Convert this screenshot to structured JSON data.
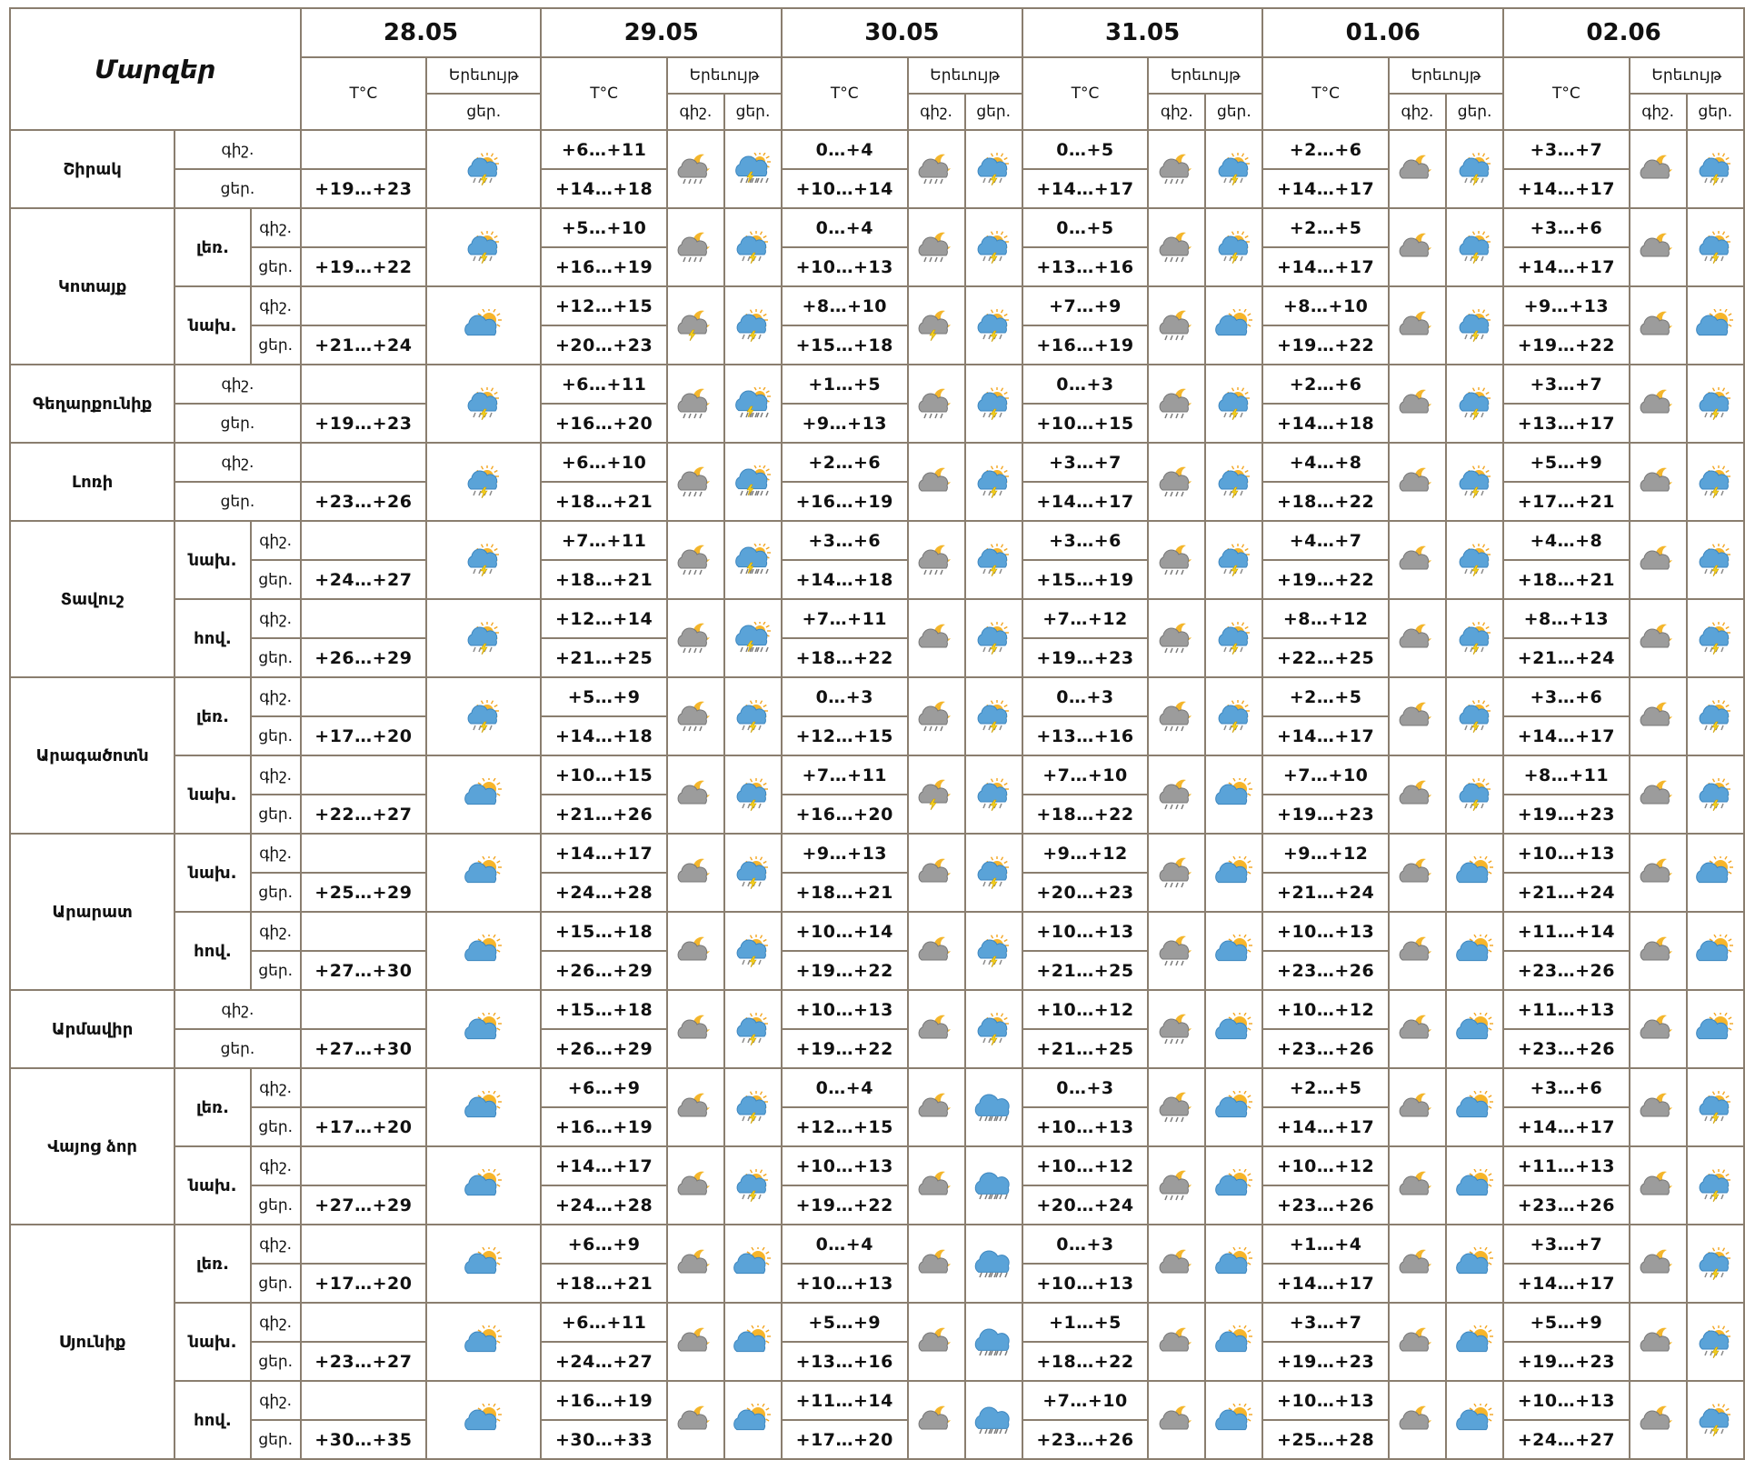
{
  "header": {
    "regions_title": "Մարզեր",
    "temp_label": "T°C",
    "phenomenon_label": "Երեւույթ",
    "night_label": "գիշ.",
    "day_label": "ցեր.",
    "dates": [
      "28.05",
      "29.05",
      "30.05",
      "31.05",
      "01.06",
      "02.06"
    ]
  },
  "icon_legend": {
    "sun-shower": "partly sunny cloud with light rain",
    "sun-thunder-rain": "sun, cloud, lightning and rain",
    "sun-cloud": "sun behind blue cloud",
    "night-cloud": "moon behind grey cloud",
    "night-cloud-rain": "moon behind grey cloud with drizzle",
    "night-cloud-thunder": "moon behind grey cloud with lightning",
    "rain-cloud": "blue cloud with rain"
  },
  "regions": [
    {
      "name": "Շիրակ",
      "subs": [
        {
          "label": "",
          "night": [
            "",
            "+6…+11",
            "0…+4",
            "0…+5",
            "+2…+6",
            "+3…+7"
          ],
          "day": [
            "+19…+23",
            "+14…+18",
            "+10…+14",
            "+14…+17",
            "+14…+17",
            "+14…+17"
          ],
          "icons_n": [
            "night-cloud-rain",
            "night-cloud-rain",
            "night-cloud-rain",
            "night-cloud",
            "night-cloud"
          ],
          "icons_d": [
            "sun-shower",
            "sun-thunder-rain",
            "sun-shower",
            "sun-shower",
            "sun-shower",
            "sun-shower"
          ]
        }
      ]
    },
    {
      "name": "Կոտայք",
      "subs": [
        {
          "label": "լեռ.",
          "night": [
            "",
            "+5…+10",
            "0…+4",
            "0…+5",
            "+2…+5",
            "+3…+6"
          ],
          "day": [
            "+19…+22",
            "+16…+19",
            "+10…+13",
            "+13…+16",
            "+14…+17",
            "+14…+17"
          ],
          "icons_n": [
            "night-cloud-rain",
            "night-cloud-rain",
            "night-cloud-rain",
            "night-cloud",
            "night-cloud"
          ],
          "icons_d": [
            "sun-shower",
            "sun-shower",
            "sun-shower",
            "sun-shower",
            "sun-shower",
            "sun-shower"
          ]
        },
        {
          "label": "նախ.",
          "night": [
            "",
            "+12…+15",
            "+8…+10",
            "+7…+9",
            "+8…+10",
            "+9…+13"
          ],
          "day": [
            "+21…+24",
            "+20…+23",
            "+15…+18",
            "+16…+19",
            "+19…+22",
            "+19…+22"
          ],
          "icons_n": [
            "night-cloud-thunder",
            "night-cloud-thunder",
            "night-cloud-rain",
            "night-cloud",
            "night-cloud"
          ],
          "icons_d": [
            "sun-cloud",
            "sun-shower",
            "sun-shower",
            "sun-cloud",
            "sun-shower",
            "sun-cloud"
          ]
        }
      ]
    },
    {
      "name": "Գեղարքունիք",
      "subs": [
        {
          "label": "",
          "night": [
            "",
            "+6…+11",
            "+1…+5",
            "0…+3",
            "+2…+6",
            "+3…+7"
          ],
          "day": [
            "+19…+23",
            "+16…+20",
            "+9…+13",
            "+10…+15",
            "+14…+18",
            "+13…+17"
          ],
          "icons_n": [
            "night-cloud-rain",
            "night-cloud-rain",
            "night-cloud-rain",
            "night-cloud",
            "night-cloud"
          ],
          "icons_d": [
            "sun-shower",
            "sun-thunder-rain",
            "sun-shower",
            "sun-shower",
            "sun-shower",
            "sun-shower"
          ]
        }
      ]
    },
    {
      "name": "Լոռի",
      "subs": [
        {
          "label": "",
          "night": [
            "",
            "+6…+10",
            "+2…+6",
            "+3…+7",
            "+4…+8",
            "+5…+9"
          ],
          "day": [
            "+23…+26",
            "+18…+21",
            "+16…+19",
            "+14…+17",
            "+18…+22",
            "+17…+21"
          ],
          "icons_n": [
            "night-cloud-rain",
            "night-cloud",
            "night-cloud-rain",
            "night-cloud",
            "night-cloud"
          ],
          "icons_d": [
            "sun-shower",
            "sun-thunder-rain",
            "sun-shower",
            "sun-shower",
            "sun-shower",
            "sun-shower"
          ]
        }
      ]
    },
    {
      "name": "Տավուշ",
      "subs": [
        {
          "label": "նախ.",
          "night": [
            "",
            "+7…+11",
            "+3…+6",
            "+3…+6",
            "+4…+7",
            "+4…+8"
          ],
          "day": [
            "+24…+27",
            "+18…+21",
            "+14…+18",
            "+15…+19",
            "+19…+22",
            "+18…+21"
          ],
          "icons_n": [
            "night-cloud-rain",
            "night-cloud-rain",
            "night-cloud-rain",
            "night-cloud",
            "night-cloud"
          ],
          "icons_d": [
            "sun-shower",
            "sun-thunder-rain",
            "sun-shower",
            "sun-shower",
            "sun-shower",
            "sun-shower"
          ]
        },
        {
          "label": "հով.",
          "night": [
            "",
            "+12…+14",
            "+7…+11",
            "+7…+12",
            "+8…+12",
            "+8…+13"
          ],
          "day": [
            "+26…+29",
            "+21…+25",
            "+18…+22",
            "+19…+23",
            "+22…+25",
            "+21…+24"
          ],
          "icons_n": [
            "night-cloud-rain",
            "night-cloud",
            "night-cloud-rain",
            "night-cloud",
            "night-cloud"
          ],
          "icons_d": [
            "sun-shower",
            "sun-thunder-rain",
            "sun-shower",
            "sun-shower",
            "sun-shower",
            "sun-shower"
          ]
        }
      ]
    },
    {
      "name": "Արագածոտն",
      "subs": [
        {
          "label": "լեռ.",
          "night": [
            "",
            "+5…+9",
            "0…+3",
            "0…+3",
            "+2…+5",
            "+3…+6"
          ],
          "day": [
            "+17…+20",
            "+14…+18",
            "+12…+15",
            "+13…+16",
            "+14…+17",
            "+14…+17"
          ],
          "icons_n": [
            "night-cloud-rain",
            "night-cloud-rain",
            "night-cloud-rain",
            "night-cloud",
            "night-cloud"
          ],
          "icons_d": [
            "sun-shower",
            "sun-shower",
            "sun-shower",
            "sun-shower",
            "sun-shower",
            "sun-shower"
          ]
        },
        {
          "label": "նախ.",
          "night": [
            "",
            "+10…+15",
            "+7…+11",
            "+7…+10",
            "+7…+10",
            "+8…+11"
          ],
          "day": [
            "+22…+27",
            "+21…+26",
            "+16…+20",
            "+18…+22",
            "+19…+23",
            "+19…+23"
          ],
          "icons_n": [
            "night-cloud",
            "night-cloud-thunder",
            "night-cloud-rain",
            "night-cloud",
            "night-cloud"
          ],
          "icons_d": [
            "sun-cloud",
            "sun-shower",
            "sun-shower",
            "sun-cloud",
            "sun-shower",
            "sun-shower"
          ]
        }
      ]
    },
    {
      "name": "Արարատ",
      "subs": [
        {
          "label": "նախ.",
          "night": [
            "",
            "+14…+17",
            "+9…+13",
            "+9…+12",
            "+9…+12",
            "+10…+13"
          ],
          "day": [
            "+25…+29",
            "+24…+28",
            "+18…+21",
            "+20…+23",
            "+21…+24",
            "+21…+24"
          ],
          "icons_n": [
            "night-cloud",
            "night-cloud",
            "night-cloud-rain",
            "night-cloud",
            "night-cloud"
          ],
          "icons_d": [
            "sun-cloud",
            "sun-shower",
            "sun-shower",
            "sun-cloud",
            "sun-cloud",
            "sun-cloud"
          ]
        },
        {
          "label": "հով.",
          "night": [
            "",
            "+15…+18",
            "+10…+14",
            "+10…+13",
            "+10…+13",
            "+11…+14"
          ],
          "day": [
            "+27…+30",
            "+26…+29",
            "+19…+22",
            "+21…+25",
            "+23…+26",
            "+23…+26"
          ],
          "icons_n": [
            "night-cloud",
            "night-cloud",
            "night-cloud-rain",
            "night-cloud",
            "night-cloud"
          ],
          "icons_d": [
            "sun-cloud",
            "sun-shower",
            "sun-shower",
            "sun-cloud",
            "sun-cloud",
            "sun-cloud"
          ]
        }
      ]
    },
    {
      "name": "Արմավիր",
      "subs": [
        {
          "label": "",
          "night": [
            "",
            "+15…+18",
            "+10…+13",
            "+10…+12",
            "+10…+12",
            "+11…+13"
          ],
          "day": [
            "+27…+30",
            "+26…+29",
            "+19…+22",
            "+21…+25",
            "+23…+26",
            "+23…+26"
          ],
          "icons_n": [
            "night-cloud",
            "night-cloud",
            "night-cloud-rain",
            "night-cloud",
            "night-cloud"
          ],
          "icons_d": [
            "sun-cloud",
            "sun-shower",
            "sun-shower",
            "sun-cloud",
            "sun-cloud",
            "sun-cloud"
          ]
        }
      ]
    },
    {
      "name": "Վայոց ձոր",
      "subs": [
        {
          "label": "լեռ.",
          "night": [
            "",
            "+6…+9",
            "0…+4",
            "0…+3",
            "+2…+5",
            "+3…+6"
          ],
          "day": [
            "+17…+20",
            "+16…+19",
            "+12…+15",
            "+10…+13",
            "+14…+17",
            "+14…+17"
          ],
          "icons_n": [
            "night-cloud",
            "night-cloud",
            "night-cloud-rain",
            "night-cloud",
            "night-cloud"
          ],
          "icons_d": [
            "sun-cloud",
            "sun-shower",
            "rain-cloud",
            "sun-cloud",
            "sun-cloud",
            "sun-shower"
          ]
        },
        {
          "label": "նախ.",
          "night": [
            "",
            "+14…+17",
            "+10…+13",
            "+10…+12",
            "+10…+12",
            "+11…+13"
          ],
          "day": [
            "+27…+29",
            "+24…+28",
            "+19…+22",
            "+20…+24",
            "+23…+26",
            "+23…+26"
          ],
          "icons_n": [
            "night-cloud",
            "night-cloud",
            "night-cloud-rain",
            "night-cloud",
            "night-cloud"
          ],
          "icons_d": [
            "sun-cloud",
            "sun-shower",
            "rain-cloud",
            "sun-cloud",
            "sun-cloud",
            "sun-shower"
          ]
        }
      ]
    },
    {
      "name": "Սյունիք",
      "subs": [
        {
          "label": "լեռ.",
          "night": [
            "",
            "+6…+9",
            "0…+4",
            "0…+3",
            "+1…+4",
            "+3…+7"
          ],
          "day": [
            "+17…+20",
            "+18…+21",
            "+10…+13",
            "+10…+13",
            "+14…+17",
            "+14…+17"
          ],
          "icons_n": [
            "night-cloud",
            "night-cloud",
            "night-cloud",
            "night-cloud",
            "night-cloud"
          ],
          "icons_d": [
            "sun-cloud",
            "sun-cloud",
            "rain-cloud",
            "sun-cloud",
            "sun-cloud",
            "sun-shower"
          ]
        },
        {
          "label": "նախ.",
          "night": [
            "",
            "+6…+11",
            "+5…+9",
            "+1…+5",
            "+3…+7",
            "+5…+9"
          ],
          "day": [
            "+23…+27",
            "+24…+27",
            "+13…+16",
            "+18…+22",
            "+19…+23",
            "+19…+23"
          ],
          "icons_n": [
            "night-cloud",
            "night-cloud",
            "night-cloud",
            "night-cloud",
            "night-cloud"
          ],
          "icons_d": [
            "sun-cloud",
            "sun-cloud",
            "rain-cloud",
            "sun-cloud",
            "sun-cloud",
            "sun-shower"
          ]
        },
        {
          "label": "հով.",
          "night": [
            "",
            "+16…+19",
            "+11…+14",
            "+7…+10",
            "+10…+13",
            "+10…+13"
          ],
          "day": [
            "+30…+35",
            "+30…+33",
            "+17…+20",
            "+23…+26",
            "+25…+28",
            "+24…+27"
          ],
          "icons_n": [
            "night-cloud",
            "night-cloud",
            "night-cloud",
            "night-cloud",
            "night-cloud"
          ],
          "icons_d": [
            "sun-cloud",
            "sun-cloud",
            "rain-cloud",
            "sun-cloud",
            "sun-cloud",
            "sun-shower"
          ]
        }
      ]
    }
  ]
}
